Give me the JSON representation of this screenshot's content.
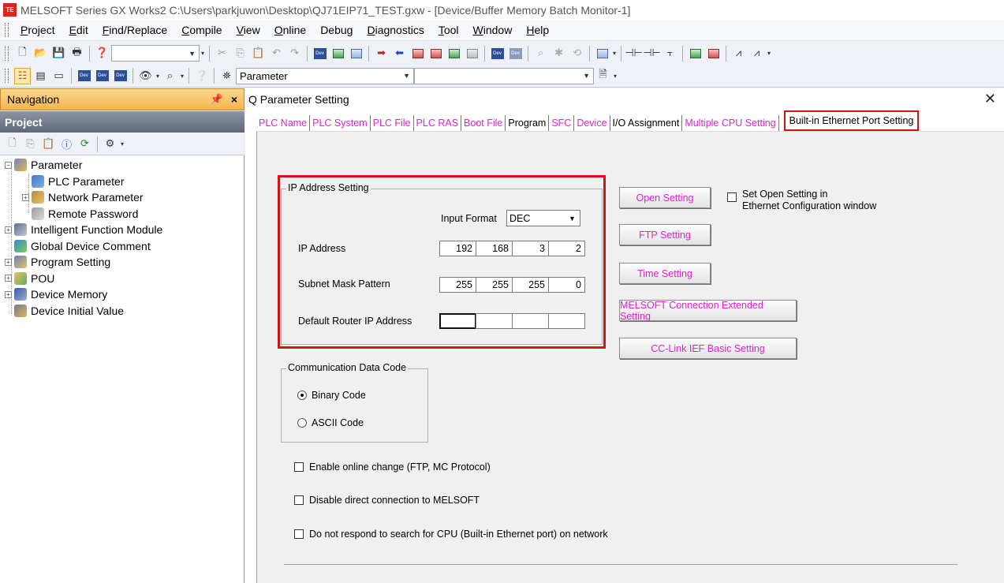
{
  "window": {
    "title": "MELSOFT Series GX Works2 C:\\Users\\parkjuwon\\Desktop\\QJ71EIP71_TEST.gxw - [Device/Buffer Memory Batch Monitor-1]",
    "logo_text": "TE"
  },
  "menu": [
    {
      "mnemonic": "P",
      "rest": "roject"
    },
    {
      "mnemonic": "E",
      "rest": "dit"
    },
    {
      "mnemonic": "F",
      "rest": "ind/Replace"
    },
    {
      "mnemonic": "C",
      "rest": "ompile"
    },
    {
      "mnemonic": "V",
      "rest": "iew"
    },
    {
      "mnemonic": "O",
      "rest": "nline"
    },
    {
      "mnemonic": "",
      "rest": "Debug"
    },
    {
      "mnemonic": "D",
      "rest": "iagnostics"
    },
    {
      "mnemonic": "T",
      "rest": "ool"
    },
    {
      "mnemonic": "W",
      "rest": "indow"
    },
    {
      "mnemonic": "H",
      "rest": "elp"
    }
  ],
  "toolbar": {
    "parameter_combo": "Parameter",
    "second_combo": ""
  },
  "navigation": {
    "header": "Navigation",
    "pin": " ᅥ",
    "close": "×",
    "project_label": "Project",
    "tree": [
      {
        "label": "Parameter",
        "level": 0,
        "expander": "−",
        "icon": "parameter-icon",
        "cls": "ti-param"
      },
      {
        "label": "PLC Parameter",
        "level": 1,
        "expander": "",
        "icon": "plc-parameter-icon",
        "cls": "ti-plc",
        "selected": true
      },
      {
        "label": "Network Parameter",
        "level": 1,
        "expander": "+",
        "icon": "network-parameter-icon",
        "cls": "ti-net"
      },
      {
        "label": "Remote Password",
        "level": 1,
        "expander": "",
        "icon": "remote-password-icon",
        "cls": "ti-remote"
      },
      {
        "label": "Intelligent Function Module",
        "level": 0,
        "expander": "+",
        "icon": "intelligent-module-icon",
        "cls": "ti-module"
      },
      {
        "label": "Global Device Comment",
        "level": 0,
        "expander": "",
        "icon": "global-comment-icon",
        "cls": "ti-global"
      },
      {
        "label": "Program Setting",
        "level": 0,
        "expander": "+",
        "icon": "program-setting-icon",
        "cls": "ti-program"
      },
      {
        "label": "POU",
        "level": 0,
        "expander": "+",
        "icon": "pou-icon",
        "cls": "ti-pou"
      },
      {
        "label": "Device Memory",
        "level": 0,
        "expander": "+",
        "icon": "device-memory-icon",
        "cls": "ti-mem"
      },
      {
        "label": "Device Initial Value",
        "level": 0,
        "expander": "",
        "icon": "device-initial-value-icon",
        "cls": "ti-init"
      }
    ]
  },
  "dialog": {
    "title": "Q Parameter Setting",
    "close": "✕",
    "tabs": [
      {
        "label": "PLC Name",
        "style": "pink"
      },
      {
        "label": "PLC System",
        "style": "pink"
      },
      {
        "label": "PLC File",
        "style": "pink"
      },
      {
        "label": "PLC RAS",
        "style": "pink"
      },
      {
        "label": "Boot File",
        "style": "pink"
      },
      {
        "label": "Program",
        "style": "black"
      },
      {
        "label": "SFC",
        "style": "pink"
      },
      {
        "label": "Device",
        "style": "pink"
      },
      {
        "label": "I/O Assignment",
        "style": "black"
      },
      {
        "label": "Multiple CPU Setting",
        "style": "pink"
      },
      {
        "label": "Built-in Ethernet Port Setting",
        "style": "active"
      }
    ],
    "ip_group": {
      "title": "IP Address Setting",
      "input_format_label": "Input Format",
      "input_format_value": "DEC",
      "ip_label": "IP Address",
      "ip": [
        "192",
        "168",
        "3",
        "2"
      ],
      "subnet_label": "Subnet Mask Pattern",
      "subnet": [
        "255",
        "255",
        "255",
        "0"
      ],
      "router_label": "Default Router IP Address",
      "router": [
        "",
        "",
        "",
        ""
      ]
    },
    "buttons": {
      "open_setting": "Open Setting",
      "ftp_setting": "FTP Setting",
      "time_setting": "Time Setting",
      "melsoft_ext": "MELSOFT Connection Extended Setting",
      "cclink": "CC-Link IEF Basic Setting"
    },
    "open_setting_checkbox": {
      "line1": "Set Open Setting in",
      "line2": "Ethernet Configuration window"
    },
    "comm_group": {
      "title": "Communication Data Code",
      "binary": "Binary Code",
      "ascii": "ASCII Code",
      "selected": "binary"
    },
    "checkboxes": {
      "online_change": "Enable online change (FTP, MC Protocol)",
      "disable_direct": "Disable direct connection to MELSOFT",
      "no_respond": "Do not respond to search for CPU (Built-in Ethernet port) on network"
    }
  },
  "colors": {
    "highlight_red": "#d01414",
    "tab_pink": "#e020d0",
    "nav_orange": "#f6b34c"
  }
}
